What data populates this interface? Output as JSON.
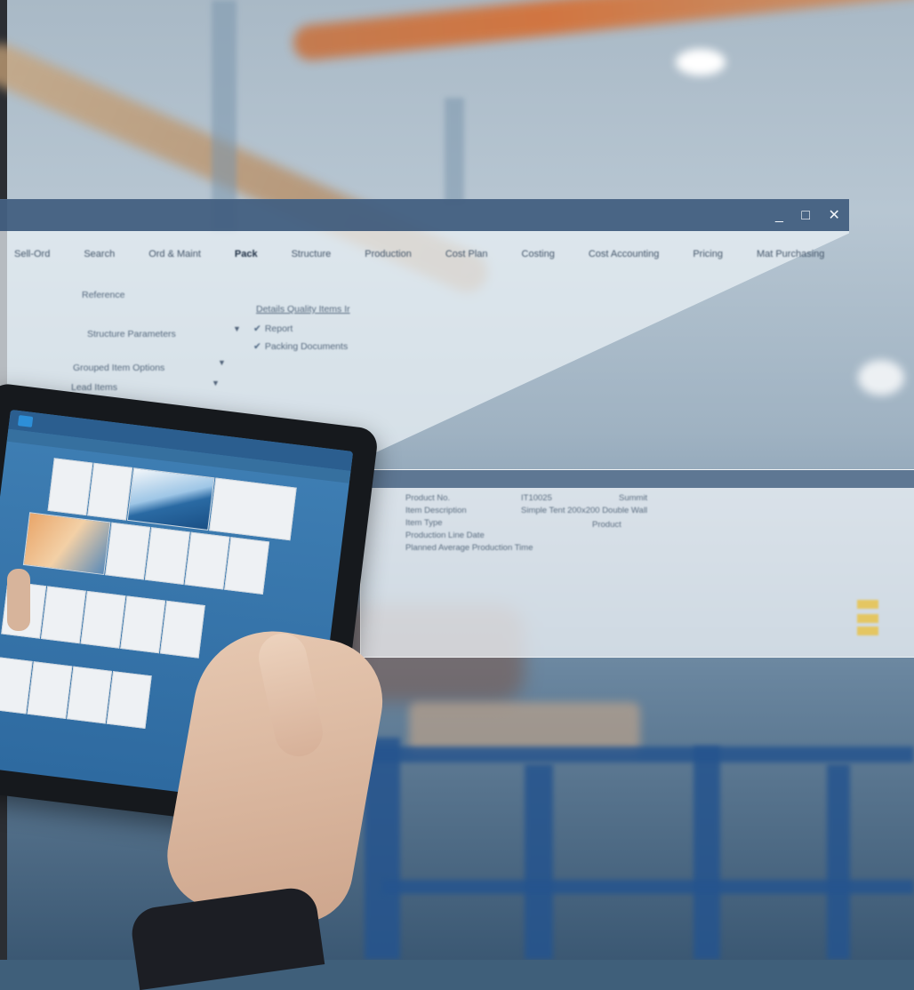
{
  "window": {
    "controls": "_ □ ✕",
    "menu": [
      "Sell-Ord",
      "Search",
      "Ord & Maint",
      "Pack",
      "Structure",
      "Production",
      "Cost Plan",
      "Costing",
      "Cost Accounting",
      "Pricing",
      "Mat Purchasing"
    ],
    "form": {
      "section_label": "Reference",
      "link": "Details Quality Items Ir",
      "field_1": "Structure Parameters",
      "check_1": "Report",
      "check_2": "Packing Documents",
      "field_2": "Grouped Item Options",
      "field_3": "Lead Items"
    }
  },
  "dialog": {
    "rows": [
      "Product No.",
      "Item Description",
      "Item Type",
      "Production Line Date",
      "Planned Average Production Time"
    ],
    "values": [
      "IT10025",
      "Summit",
      "Product",
      "Simple Tent 200x200 Double Wall"
    ]
  },
  "colors": {
    "titlebar": "#28486e",
    "glass": "#ecf2f7",
    "tablet_screen": "#3f7fb4",
    "accent_orange": "#d86a2a"
  }
}
